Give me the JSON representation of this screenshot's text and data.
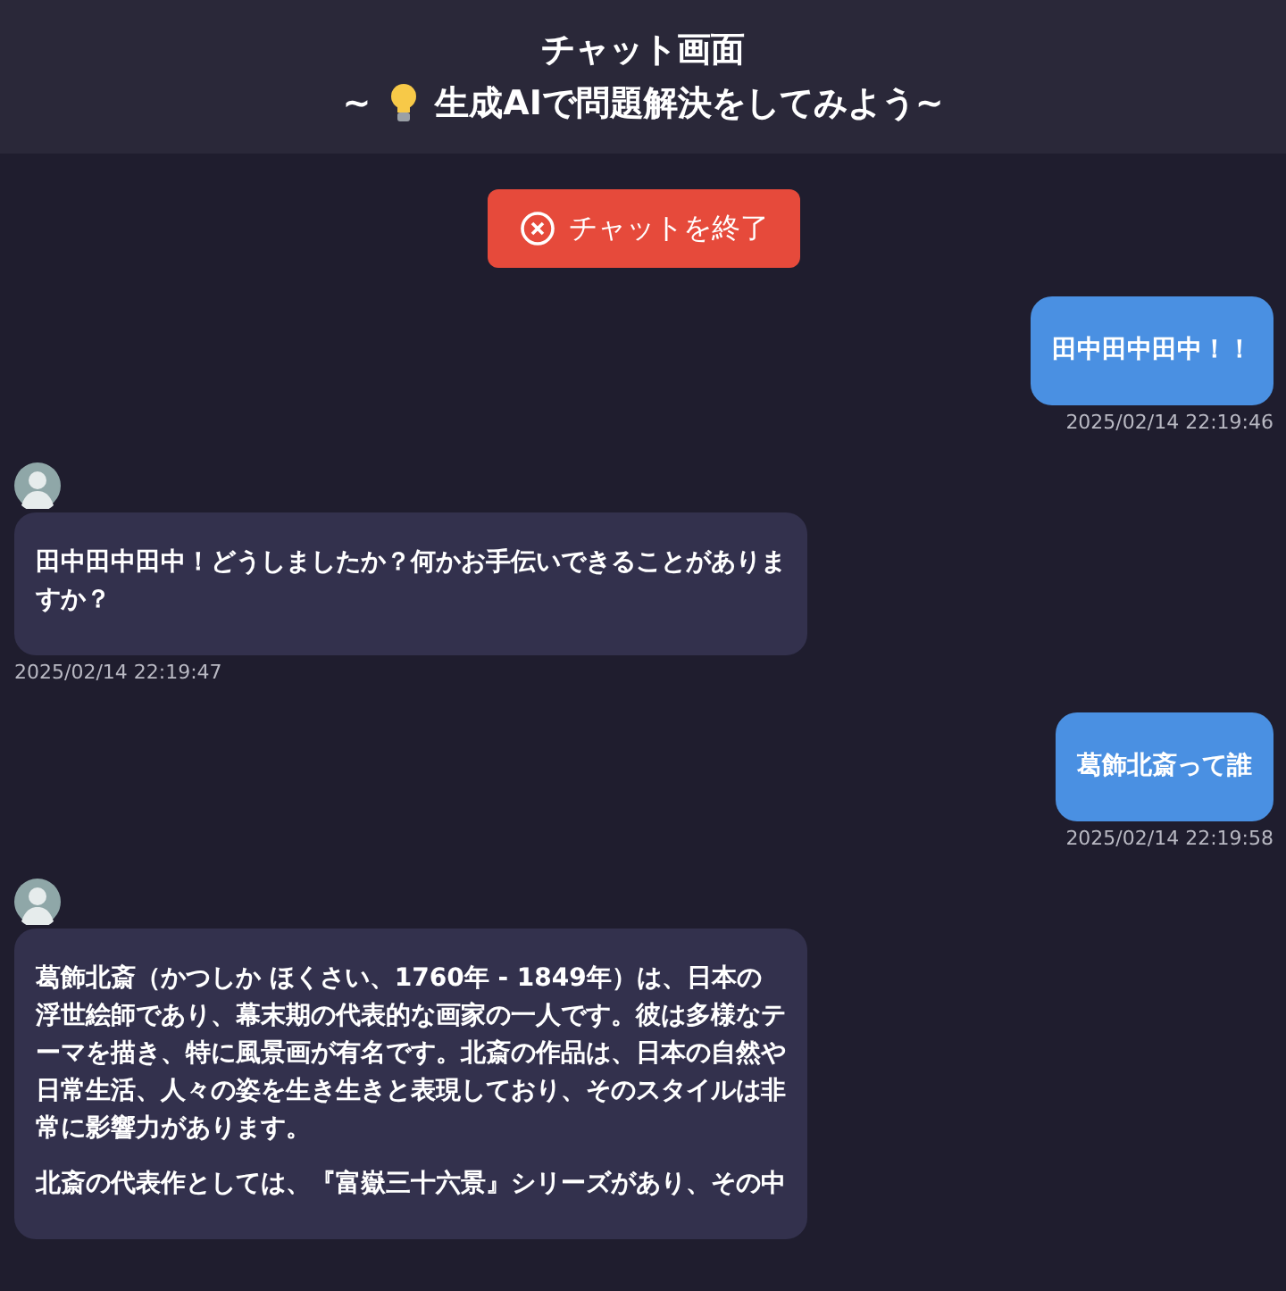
{
  "header": {
    "title": "チャット画面",
    "subtitle_prefix": "~",
    "subtitle": "生成AIで問題解決をしてみよう~"
  },
  "end_button": {
    "label": "チャットを終了"
  },
  "messages": [
    {
      "kind": "user",
      "paragraphs": [
        "田中田中田中！！"
      ],
      "time": "2025/02/14 22:19:46"
    },
    {
      "kind": "bot",
      "paragraphs": [
        "田中田中田中！どうしましたか？何かお手伝いできることがありますか？"
      ],
      "time": "2025/02/14 22:19:47"
    },
    {
      "kind": "user",
      "paragraphs": [
        "葛飾北斎って誰"
      ],
      "time": "2025/02/14 22:19:58"
    },
    {
      "kind": "bot",
      "paragraphs": [
        "葛飾北斎（かつしか ほくさい、1760年 - 1849年）は、日本の浮世絵師であり、幕末期の代表的な画家の一人です。彼は多様なテーマを描き、特に風景画が有名です。北斎の作品は、日本の自然や日常生活、人々の姿を生き生きと表現しており、そのスタイルは非常に影響力があります。",
        "北斎の代表作としては、『富嶽三十六景』シリーズがあり、その中"
      ]
    }
  ]
}
